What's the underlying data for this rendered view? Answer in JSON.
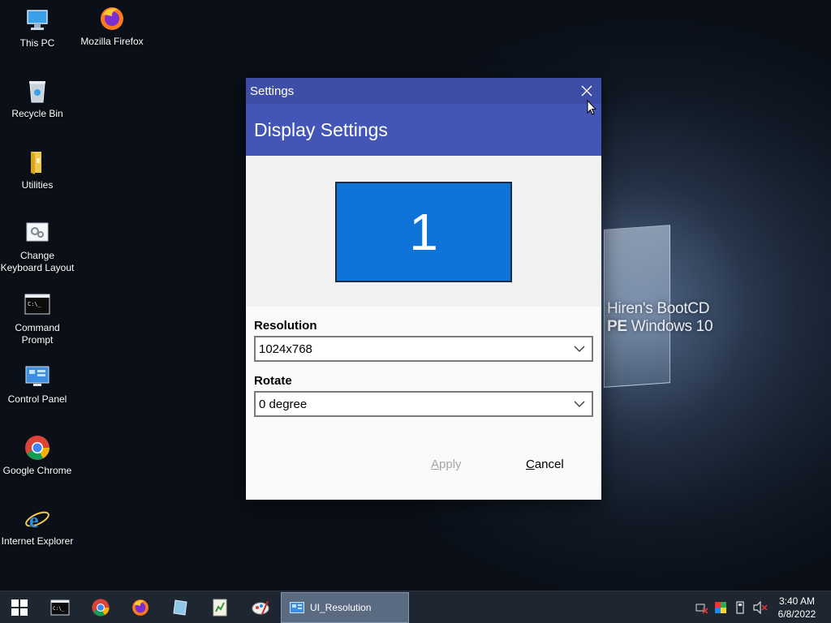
{
  "desktop": {
    "icons": [
      {
        "label": "This PC"
      },
      {
        "label": "Mozilla Firefox"
      },
      {
        "label": "Recycle Bin"
      },
      {
        "label": "Utilities"
      },
      {
        "label": "Change Keyboard Layout"
      },
      {
        "label": "Command Prompt"
      },
      {
        "label": "Control Panel"
      },
      {
        "label": "Google Chrome"
      },
      {
        "label": "Internet Explorer"
      }
    ],
    "wallpaper": {
      "line1": "Hiren's BootCD",
      "line2_bold": "PE",
      "line2_rest": " Windows 10"
    }
  },
  "dialog": {
    "window_title": "Settings",
    "header": "Display Settings",
    "monitor_number": "1",
    "resolution_label": "Resolution",
    "resolution_value": "1024x768",
    "rotate_label": "Rotate",
    "rotate_value": "0 degree",
    "apply_mnemonic": "A",
    "apply_rest": "pply",
    "cancel_mnemonic": "C",
    "cancel_rest": "ancel"
  },
  "taskbar": {
    "active_task": "UI_Resolution",
    "clock_time": "3:40 AM",
    "clock_date": "6/8/2022"
  },
  "colors": {
    "titlebar": "#3e4ea6",
    "header": "#4356b8",
    "monitor": "#0e74d8",
    "taskbar": "#1e2632"
  }
}
